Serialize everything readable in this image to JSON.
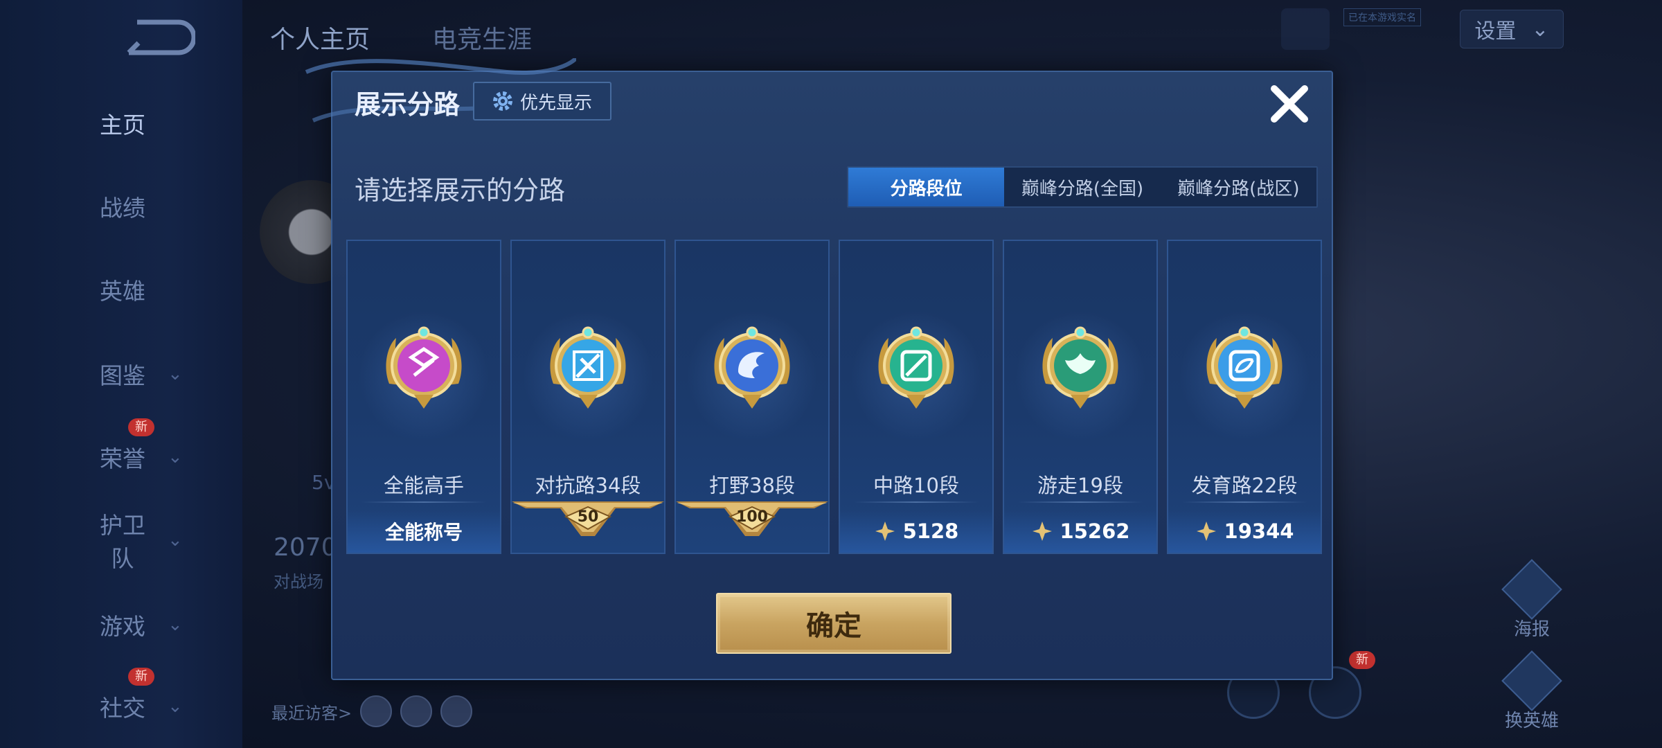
{
  "sidebar": {
    "items": [
      {
        "label": "主页",
        "active": true,
        "has_chevron": false,
        "badge": ""
      },
      {
        "label": "战绩",
        "active": false,
        "has_chevron": false,
        "badge": ""
      },
      {
        "label": "英雄",
        "active": false,
        "has_chevron": false,
        "badge": ""
      },
      {
        "label": "图鉴",
        "active": false,
        "has_chevron": true,
        "badge": ""
      },
      {
        "label": "荣誉",
        "active": false,
        "has_chevron": true,
        "badge": "新"
      },
      {
        "label": "护卫队",
        "active": false,
        "has_chevron": true,
        "badge": ""
      },
      {
        "label": "游戏",
        "active": false,
        "has_chevron": true,
        "badge": ""
      },
      {
        "label": "社交",
        "active": false,
        "has_chevron": true,
        "badge": "新"
      }
    ]
  },
  "profile": {
    "tabs": [
      "个人主页",
      "电竞生涯"
    ],
    "stat_value": "2070",
    "stat_label": "对战场",
    "side_text": "5v",
    "visitors_label": "最近访客>"
  },
  "topbar": {
    "badge_text": "已在本游戏实名",
    "settings_label": "设置"
  },
  "right_actions": {
    "poster_label": "海报",
    "change_hero_label": "换英雄",
    "new_badge": "新"
  },
  "modal": {
    "title": "展示分路",
    "priority_label": "优先显示",
    "subtitle": "请选择展示的分路",
    "tabs": [
      {
        "label": "分路段位",
        "active": true
      },
      {
        "label": "巅峰分路(全国)",
        "active": false
      },
      {
        "label": "巅峰分路(战区)",
        "active": false
      }
    ],
    "cards": [
      {
        "name": "全能高手",
        "bottom": "全能称号",
        "bottom_type": "text",
        "medal_color": "#c64bc9",
        "medal_icon": "all-round-icon"
      },
      {
        "name": "对抗路34段",
        "bottom": "50",
        "bottom_type": "ribbon",
        "medal_color": "#36a6e6",
        "medal_icon": "sword-icon"
      },
      {
        "name": "打野38段",
        "bottom": "100",
        "bottom_type": "ribbon",
        "medal_color": "#3a6fd8",
        "medal_icon": "dragon-icon"
      },
      {
        "name": "中路10段",
        "bottom": "5128",
        "bottom_type": "score",
        "medal_color": "#27b38f",
        "medal_icon": "mid-lane-icon"
      },
      {
        "name": "游走19段",
        "bottom": "15262",
        "bottom_type": "score",
        "medal_color": "#2a9c78",
        "medal_icon": "wings-icon"
      },
      {
        "name": "发育路22段",
        "bottom": "19344",
        "bottom_type": "score",
        "medal_color": "#3b9de8",
        "medal_icon": "marksman-icon"
      }
    ],
    "confirm_label": "确定"
  },
  "colors": {
    "accent_tab": "#2f7bd6",
    "confirm_gold": "#c9a461",
    "new_badge": "#c2312f"
  }
}
